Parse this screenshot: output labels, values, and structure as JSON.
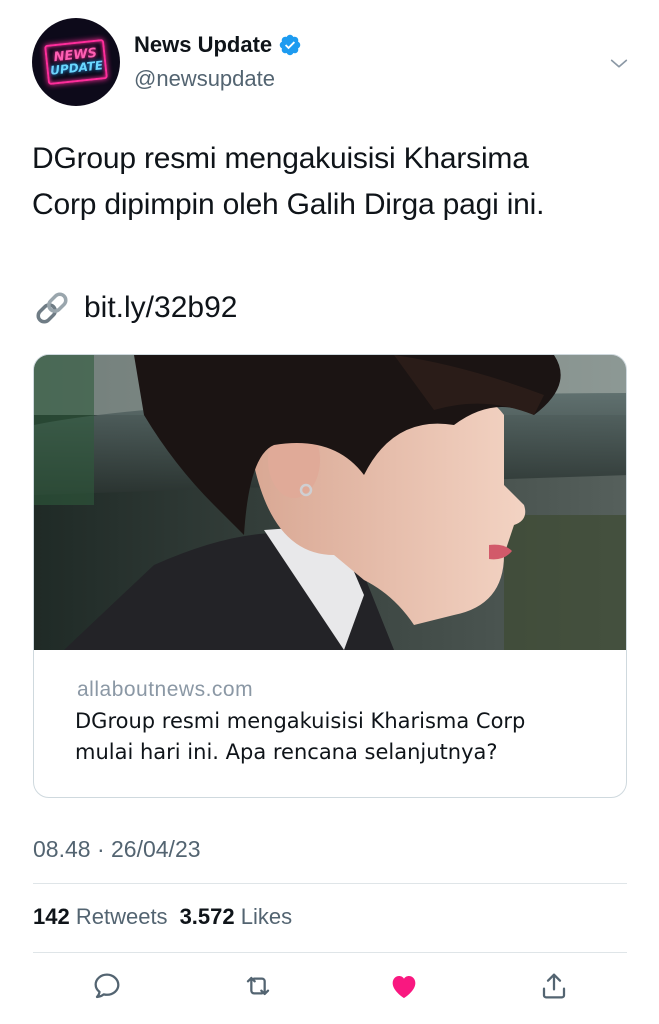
{
  "account": {
    "display_name": "News Update",
    "handle": "@newsupdate",
    "verified": true,
    "avatar_logo_top": "NEWS",
    "avatar_logo_bottom": "UPDATE"
  },
  "tweet": {
    "text_line1": "DGroup resmi mengakuisisi Kharsima",
    "text_line2": "Corp dipimpin oleh Galih Dirga pagi ini.",
    "link_emoji": "link-icon",
    "link_text": "bit.ly/32b92"
  },
  "card": {
    "domain": "allaboutnews.com",
    "title_line1": "DGroup resmi mengakuisisi Kharisma Corp",
    "title_line2": "mulai hari ini. Apa rencana selanjutnya?"
  },
  "meta": {
    "timestamp": "08.48 · 26/04/23"
  },
  "stats": {
    "retweets_count": "142",
    "retweets_label": "Retweets",
    "likes_count": "3.572",
    "likes_label": "Likes"
  },
  "colors": {
    "verified_blue": "#1d9bf0",
    "like_red": "#f91880",
    "secondary_text": "#536471"
  },
  "actions": [
    "reply-icon",
    "retweet-icon",
    "like-icon",
    "share-icon"
  ]
}
